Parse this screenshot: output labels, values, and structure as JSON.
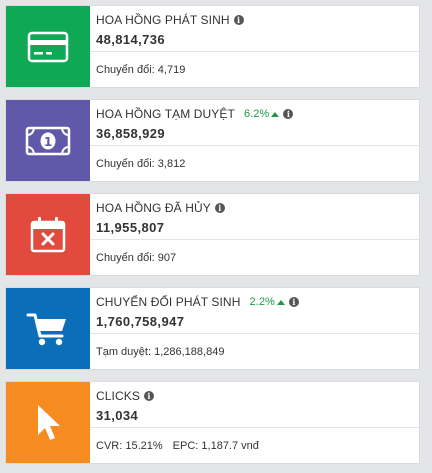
{
  "colors": {
    "green": "#0fa955",
    "purple": "#6058a8",
    "red": "#e14a3c",
    "blue": "#0a6eb8",
    "orange": "#f68b1f",
    "positive": "#1a9a47"
  },
  "cards": [
    {
      "icon": "credit-card-icon",
      "title": "HOA HỒNG PHÁT SINH",
      "change": "",
      "value": "48,814,736",
      "footer_label": "Chuyển đổi:",
      "footer_value": "4,719"
    },
    {
      "icon": "banknote-icon",
      "title": "HOA HỒNG TẠM DUYỆT",
      "change": "6.2%",
      "value": "36,858,929",
      "footer_label": "Chuyển đổi:",
      "footer_value": "3,812"
    },
    {
      "icon": "calendar-cancel-icon",
      "title": "HOA HỒNG ĐÃ HỦY",
      "change": "",
      "value": "11,955,807",
      "footer_label": "Chuyển đổi:",
      "footer_value": "907"
    },
    {
      "icon": "shopping-cart-icon",
      "title": "CHUYỂN ĐỔI PHÁT SINH",
      "change": "2.2%",
      "value": "1,760,758,947",
      "footer_label": "Tạm duyệt:",
      "footer_value": "1,286,188,849"
    },
    {
      "icon": "cursor-pointer-icon",
      "title": "CLICKS",
      "change": "",
      "value": "31,034",
      "footer_label": "CVR:",
      "footer_value": "15.21%",
      "footer_label2": "EPC:",
      "footer_value2": "1,187.7 vnđ"
    }
  ]
}
